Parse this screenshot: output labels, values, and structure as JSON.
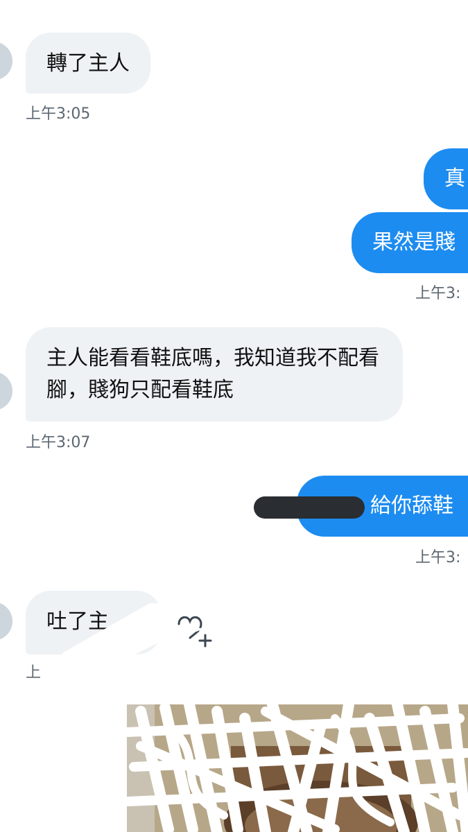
{
  "messages": [
    {
      "direction": "in",
      "text": "轉了主人",
      "time": "上午3:05"
    },
    {
      "direction": "out",
      "text": "真"
    },
    {
      "direction": "out",
      "text": "果然是賤",
      "time": "上午3:"
    },
    {
      "direction": "in",
      "text": "主人能看看鞋底嗎，我知道我不配看腳，賤狗只配看鞋底",
      "time": "上午3:07"
    },
    {
      "direction": "out",
      "text": "給你舔鞋",
      "time": "上午3:"
    },
    {
      "direction": "in",
      "text": "吐了主",
      "time": "上"
    }
  ],
  "colors": {
    "incoming_bubble": "#eef2f5",
    "outgoing_bubble": "#1d8cf0",
    "timestamp": "#5b6670",
    "avatar": "#cdd5dd"
  },
  "icons": {
    "reaction": "add-reaction-icon"
  }
}
